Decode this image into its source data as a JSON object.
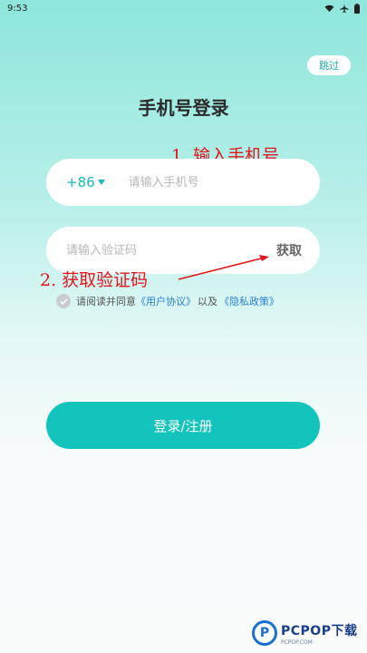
{
  "status_bar": {
    "time": "9:53"
  },
  "header": {
    "skip_label": "跳过",
    "title": "手机号登录"
  },
  "annotations": {
    "step1": "1. 输入手机号",
    "step2": "2. 获取验证码"
  },
  "phone": {
    "country_code": "+86",
    "placeholder": "请输入手机号",
    "value": ""
  },
  "code": {
    "placeholder": "请输入验证码",
    "value": "",
    "get_code_label": "获取"
  },
  "agreement": {
    "prefix": "请阅读并同意",
    "user_agreement": "《用户协议》",
    "and": "以及",
    "privacy_policy": "《隐私政策》",
    "checked": false
  },
  "login_button_label": "登录/注册",
  "watermark": {
    "brand": "PCPOP下载",
    "sub": "PCPOP.COM"
  },
  "colors": {
    "accent": "#13c4bd",
    "annotation": "#e3151d",
    "link": "#2a7fd6"
  },
  "icons": [
    "wifi-icon",
    "airplane-icon",
    "battery-icon",
    "dropdown-triangle-icon",
    "check-circle-icon"
  ]
}
